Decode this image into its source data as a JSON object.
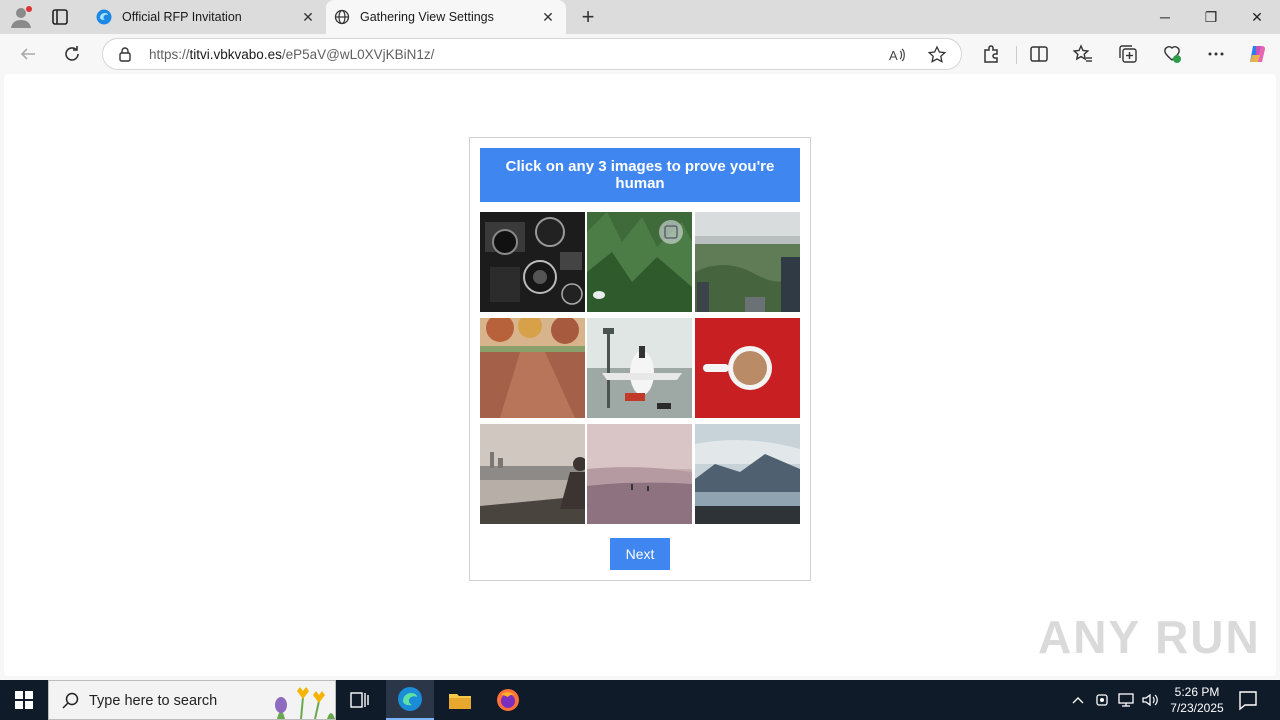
{
  "browser": {
    "tabs": [
      {
        "title": "Official RFP Invitation",
        "active": false
      },
      {
        "title": "Gathering View Settings",
        "active": true
      }
    ],
    "url_prefix": "https://",
    "url_domain": "titvi.vbkvabo.es",
    "url_path": "/eP5aV@wL0XVjKBiN1z/",
    "readaloud_label": "A̅"
  },
  "captcha": {
    "instruction": "Click on any 3 images to prove you're human",
    "images": [
      {
        "label": "vintage-cameras"
      },
      {
        "label": "bird-in-trees"
      },
      {
        "label": "city-park-aerial"
      },
      {
        "label": "autumn-path"
      },
      {
        "label": "airplane-at-gate"
      },
      {
        "label": "coffee-on-red"
      },
      {
        "label": "person-at-lake"
      },
      {
        "label": "misty-beach"
      },
      {
        "label": "coastal-mountains"
      }
    ],
    "next_label": "Next",
    "accent_color": "#3f86f0"
  },
  "watermark": "ANY RUN",
  "taskbar": {
    "search_placeholder": "Type here to search",
    "time": "5:26 PM",
    "date": "7/23/2025"
  }
}
